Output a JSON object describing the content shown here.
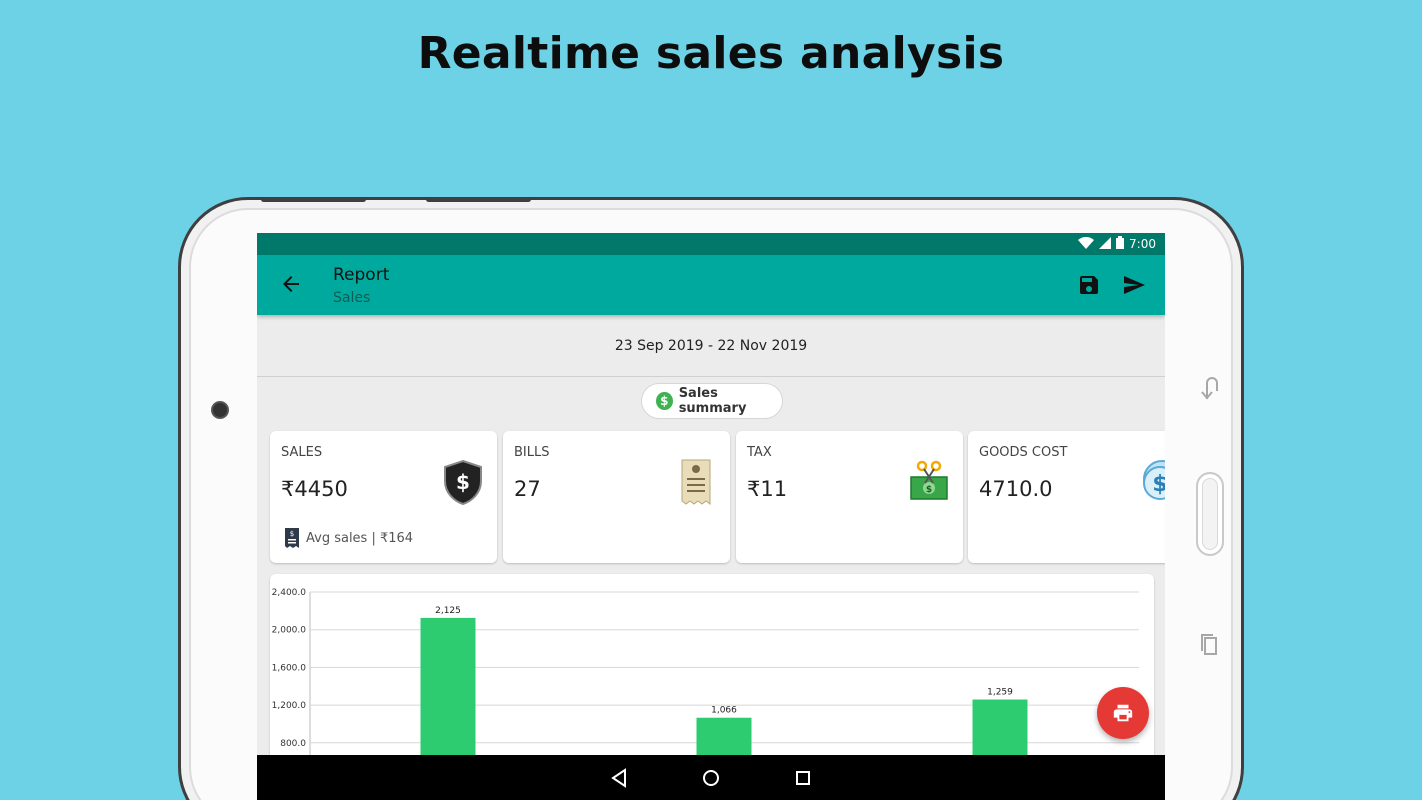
{
  "headline": "Realtime sales analysis",
  "status_bar": {
    "time": "7:00"
  },
  "app_bar": {
    "title": "Report",
    "subtitle": "Sales"
  },
  "date_range": "23 Sep 2019 - 22 Nov 2019",
  "summary_chip": {
    "label": "Sales summary"
  },
  "cards": [
    {
      "label": "SALES",
      "value": "₹4450",
      "footer": "Avg sales | ₹164",
      "icon": "shield-dollar-icon"
    },
    {
      "label": "BILLS",
      "value": "27",
      "icon": "receipt-icon"
    },
    {
      "label": "TAX",
      "value": "₹11",
      "icon": "cash-scissors-icon"
    },
    {
      "label": "GOODS COST",
      "value": "4710.0",
      "icon": "coin-dollar-icon"
    }
  ],
  "colors": {
    "accent": "#00a99d",
    "status_bar": "#00796b",
    "bar": "#2ecc71",
    "fab": "#e53935"
  },
  "chart_data": {
    "type": "bar",
    "y_ticks": [
      "800.0",
      "1,200.0",
      "1,600.0",
      "2,000.0",
      "2,400.0"
    ],
    "ylim": [
      800,
      2400
    ],
    "values": [
      2125,
      1066,
      1259
    ],
    "value_labels": [
      "2,125",
      "1,066",
      "1,259"
    ],
    "grid": true
  }
}
